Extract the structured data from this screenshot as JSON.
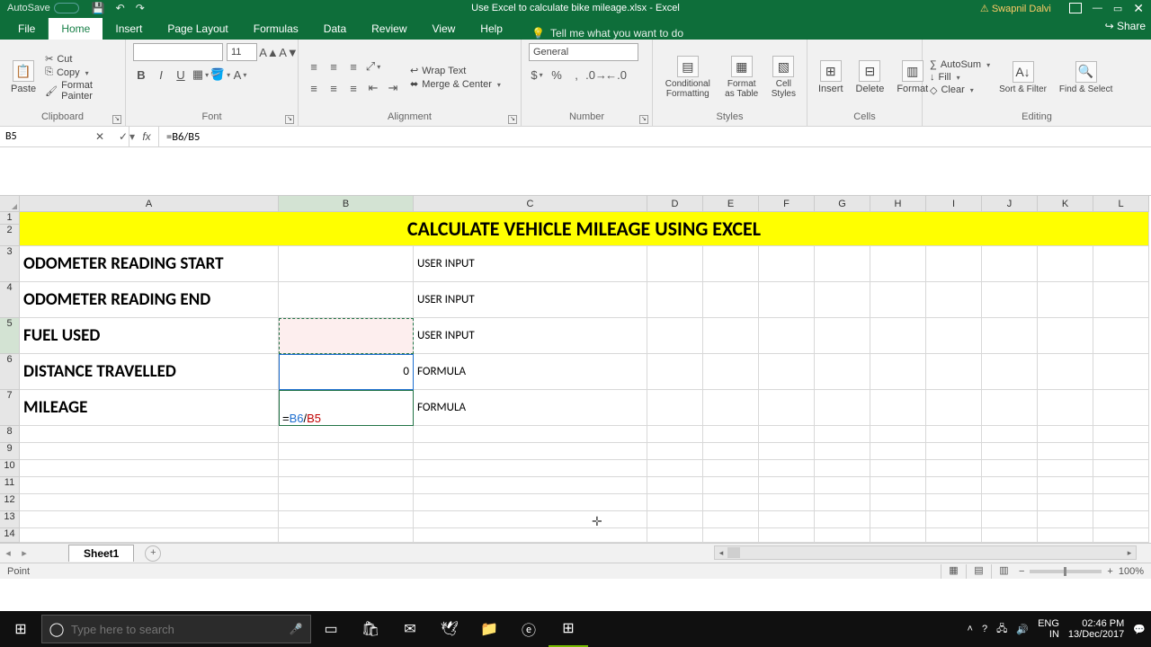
{
  "titlebar": {
    "autosave": "AutoSave",
    "title": "Use Excel to calculate bike mileage.xlsx - Excel",
    "user": "Swapnil Dalvi",
    "share": "Share"
  },
  "tabs": {
    "file": "File",
    "home": "Home",
    "insert": "Insert",
    "pageLayout": "Page Layout",
    "formulas": "Formulas",
    "data": "Data",
    "review": "Review",
    "view": "View",
    "help": "Help",
    "tellme": "Tell me what you want to do"
  },
  "ribbon": {
    "clipboard": {
      "paste": "Paste",
      "cut": "Cut",
      "copy": "Copy",
      "painter": "Format Painter",
      "label": "Clipboard"
    },
    "font": {
      "size": "11",
      "label": "Font"
    },
    "alignment": {
      "wrap": "Wrap Text",
      "merge": "Merge & Center",
      "label": "Alignment"
    },
    "number": {
      "format": "General",
      "label": "Number"
    },
    "styles": {
      "cond": "Conditional Formatting",
      "table": "Format as Table",
      "cell": "Cell Styles",
      "label": "Styles"
    },
    "cells": {
      "insert": "Insert",
      "delete": "Delete",
      "format": "Format",
      "label": "Cells"
    },
    "editing": {
      "autosum": "AutoSum",
      "fill": "Fill",
      "clear": "Clear",
      "sort": "Sort & Filter",
      "find": "Find & Select",
      "label": "Editing"
    }
  },
  "formula": {
    "nameBox": "B5",
    "fx_display": "=B6/B5",
    "edit_prefix": "=",
    "edit_b6": "B6",
    "edit_slash": "/",
    "edit_b5": "B5"
  },
  "sheet": {
    "columns": [
      "A",
      "B",
      "C",
      "D",
      "E",
      "F",
      "G",
      "H",
      "I",
      "J",
      "K",
      "L"
    ],
    "row1_2_title": "CALCULATE VEHICLE MILEAGE USING EXCEL",
    "r3": {
      "a": "ODOMETER READING START",
      "c": "USER INPUT"
    },
    "r4": {
      "a": "ODOMETER READING END",
      "c": "USER INPUT"
    },
    "r5": {
      "a": "FUEL USED",
      "c": "USER INPUT"
    },
    "r6": {
      "a": "DISTANCE TRAVELLED",
      "b": "0",
      "c": "FORMULA"
    },
    "r7": {
      "a": "MILEAGE",
      "c": "FORMULA"
    },
    "sheetName": "Sheet1"
  },
  "status": {
    "mode": "Point",
    "zoom": "100%"
  },
  "taskbar": {
    "searchPlaceholder": "Type here to search",
    "lang": "ENG",
    "kbd": "IN",
    "time": "02:46 PM",
    "date": "13/Dec/2017"
  }
}
